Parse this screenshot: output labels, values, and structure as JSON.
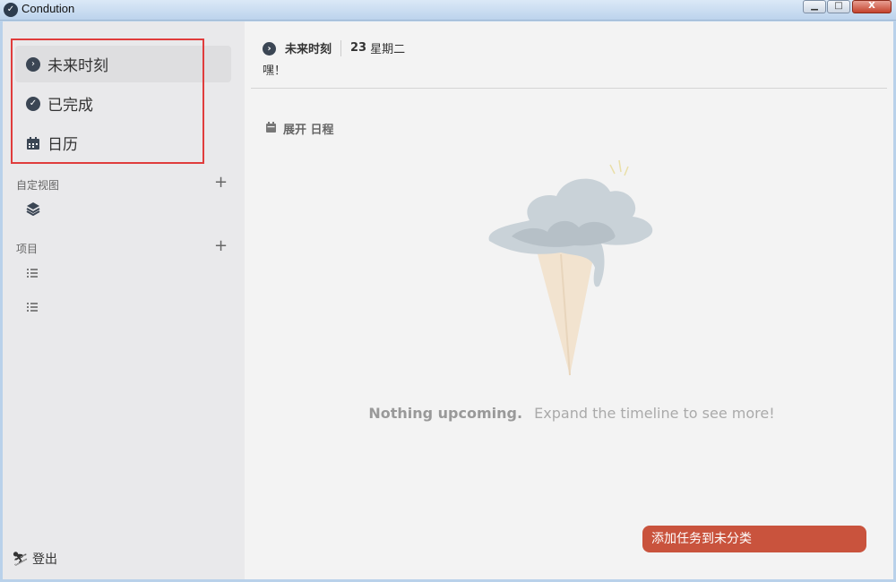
{
  "window": {
    "title": "Condution",
    "minimize": "▁",
    "maximize": "□",
    "close": "X"
  },
  "sidebar": {
    "nav": [
      {
        "label": "未来时刻",
        "icon": "chevron-right-circle-icon"
      },
      {
        "label": "已完成",
        "icon": "check-circle-icon"
      },
      {
        "label": "日历",
        "icon": "calendar-icon"
      }
    ],
    "custom_views_label": "自定视图",
    "projects_label": "项目",
    "logout_label": "登出"
  },
  "header": {
    "title": "未来时刻",
    "date_num": "23",
    "weekday": "星期二",
    "greeting": "嘿！"
  },
  "main": {
    "expand_label": "展开 日程",
    "empty_bold": "Nothing upcoming.",
    "empty_text": "Expand the timeline to see more!",
    "add_task_label": "添加任务到未分类"
  },
  "colors": {
    "accent": "#c9533d",
    "highlight": "#e03c3c",
    "sidebar_bg": "#e9e9eb"
  }
}
